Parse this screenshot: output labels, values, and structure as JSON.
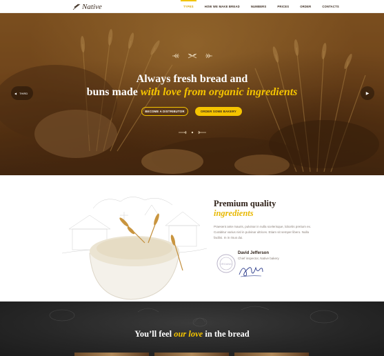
{
  "header": {
    "logo_text": "Native",
    "nav": [
      "TYPES",
      "HOW WE MAKE BREAD",
      "NUMBERS",
      "PRICES",
      "ORDER",
      "CONTACTS"
    ],
    "active_index": 0
  },
  "hero": {
    "title_line1": "Always fresh bread and",
    "title_line2_plain": "buns made ",
    "title_line2_highlight": "with love from organic ingredients",
    "btn_distributor": "BECOME A DISTRIBUTOR",
    "btn_order": "ORDER SOME BAKERY",
    "prev_label": "THIRD",
    "prev_icon": "chevron-left-icon",
    "next_icon": "chevron-right-icon"
  },
  "premium": {
    "title": "Premium quality",
    "subtitle": "ingredients",
    "text": "Praesent ante mauris, pulvinar in nulla scelerisque, lobortis pretium ex. Curabitur varius nisl in pulvinar ultrices. Etiam sit semper libero. Nulla facilisi. In in risus dui.",
    "person_name": "David Jefferson",
    "person_role": "Chief inspector, Native bakery",
    "stamp_text": "ORGANIC"
  },
  "love": {
    "plain_start": "You’ll feel ",
    "highlight": "our love",
    "plain_end": " in the bread"
  },
  "colors": {
    "accent": "#f5c400",
    "dark_brown": "#2b1d14",
    "hero_brown": "#7a4c1e"
  }
}
